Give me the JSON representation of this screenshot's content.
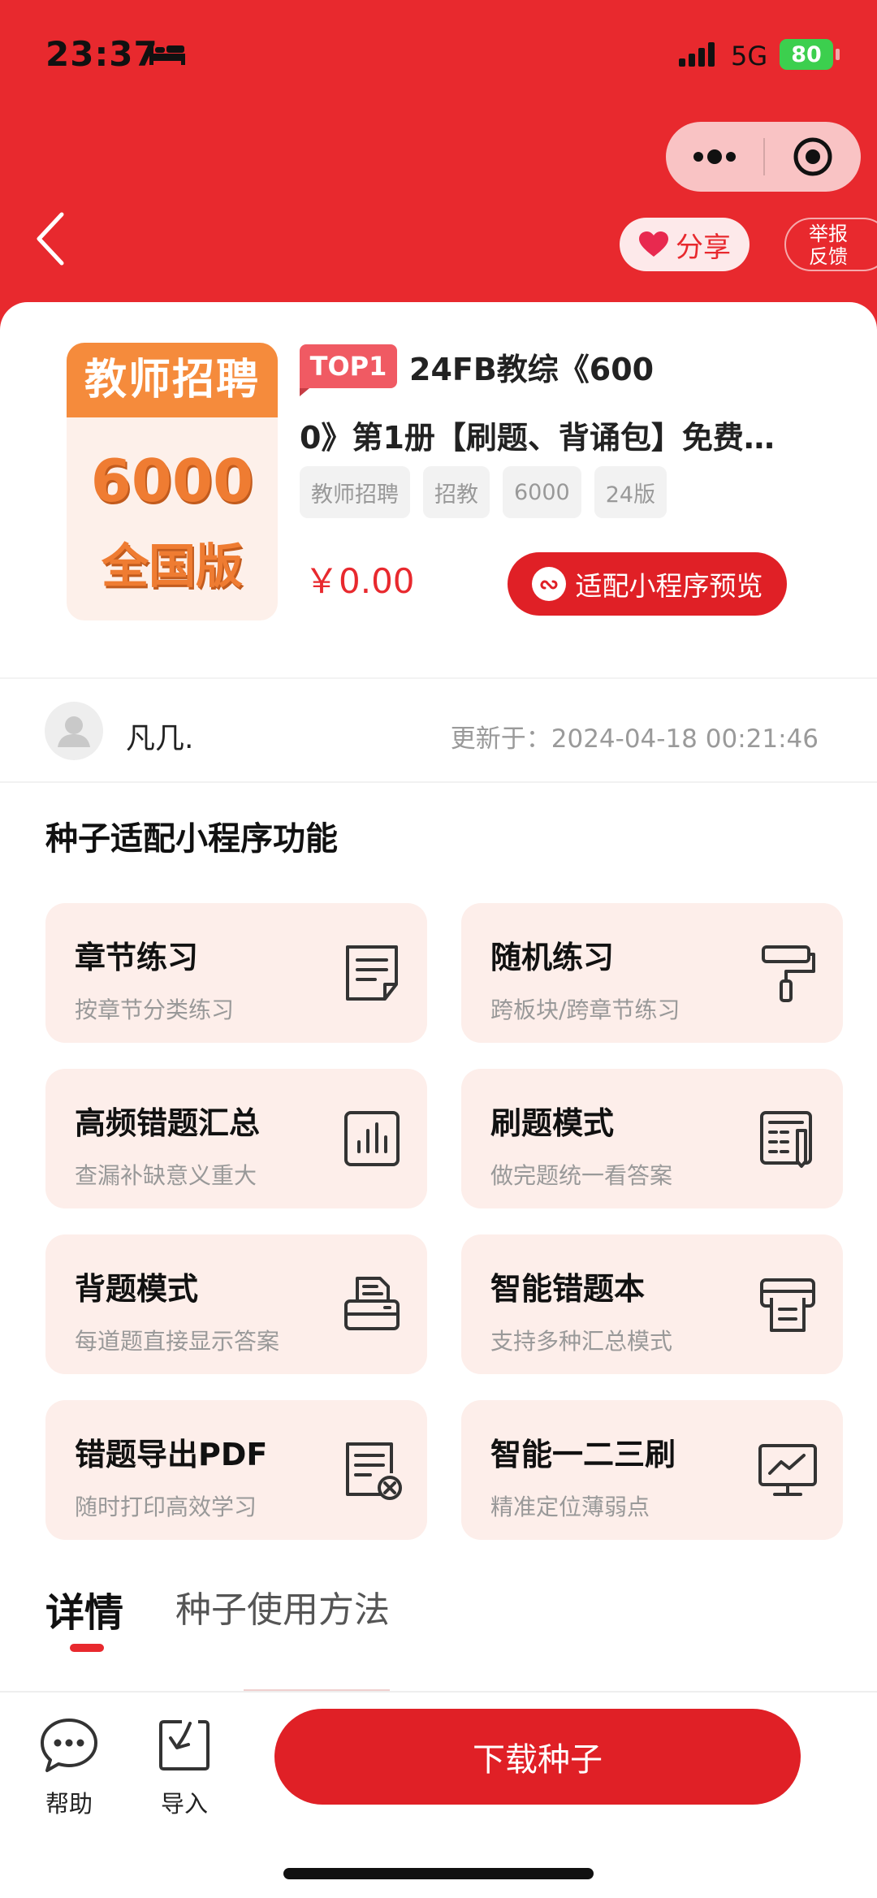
{
  "status_bar": {
    "time": "23:37",
    "network": "5G",
    "battery": "80"
  },
  "nav": {
    "share_label": "分享",
    "report_line1": "举报",
    "report_line2": "反馈"
  },
  "product": {
    "cover": {
      "top": "教师招聘",
      "number": "6000",
      "sub": "全国版"
    },
    "badge": "TOP1",
    "title_line1": "24FB教综《600",
    "title_line2": "0》第1册【刷题、背诵包】免费…",
    "tags": [
      "教师招聘",
      "招教",
      "6000",
      "24版"
    ],
    "price": "￥0.00",
    "preview_label": "适配小程序预览"
  },
  "author": {
    "name": "凡几.",
    "updated": "更新于：2024-04-18 00:21:46"
  },
  "section_title": "种子适配小程序功能",
  "features": [
    {
      "title": "章节练习",
      "subtitle": "按章节分类练习",
      "icon": "document-icon"
    },
    {
      "title": "随机练习",
      "subtitle": "跨板块/跨章节练习",
      "icon": "paint-roller-icon"
    },
    {
      "title": "高频错题汇总",
      "subtitle": "查漏补缺意义重大",
      "icon": "bar-chart-icon"
    },
    {
      "title": "刷题模式",
      "subtitle": "做完题统一看答案",
      "icon": "answer-sheet-icon"
    },
    {
      "title": "背题模式",
      "subtitle": "每道题直接显示答案",
      "icon": "printer-icon"
    },
    {
      "title": "智能错题本",
      "subtitle": "支持多种汇总模式",
      "icon": "print-output-icon"
    },
    {
      "title": "错题导出PDF",
      "subtitle": "随时打印高效学习",
      "icon": "document-export-icon"
    },
    {
      "title": "智能一二三刷",
      "subtitle": "精准定位薄弱点",
      "icon": "trend-monitor-icon"
    }
  ],
  "tabs": {
    "details": "详情",
    "usage": "种子使用方法"
  },
  "bottom_bar": {
    "help": "帮助",
    "import": "导入",
    "download": "下载种子"
  },
  "colors": {
    "brand_red": "#e8292e",
    "feature_bg": "#fdeeea",
    "cover_orange": "#f58b3c"
  }
}
